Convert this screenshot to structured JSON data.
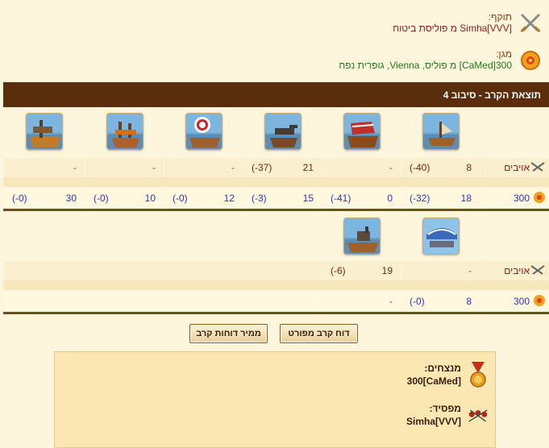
{
  "attacker": {
    "label": "תוקף:",
    "name": "Simha[VVV] מ פוליסת ביטוח"
  },
  "defender": {
    "label": "מגן:",
    "name": "300[CaMed] מ פוליס, Vienna, גופרית נפח"
  },
  "header": {
    "title": "תוצאת הקרב - סיבוב 4"
  },
  "round1": {
    "enemy_label": "אויבים",
    "own_count": "300",
    "enemy": [
      [
        "8",
        "(-40)"
      ],
      [
        "-",
        ""
      ],
      [
        "21",
        "(-37)"
      ],
      [
        "-",
        ""
      ],
      [
        "-",
        ""
      ],
      [
        "-",
        ""
      ]
    ],
    "own": [
      [
        "18",
        "(-32)"
      ],
      [
        "0",
        "(-41)"
      ],
      [
        "15",
        "(-3)"
      ],
      [
        "12",
        "(-0)"
      ],
      [
        "10",
        "(-0)"
      ],
      [
        "30",
        "(-0)"
      ]
    ]
  },
  "round2": {
    "enemy_label": "אויבים",
    "own_count": "300",
    "enemy": [
      [
        "-",
        ""
      ],
      [
        "19",
        "(-6)"
      ]
    ],
    "own": [
      [
        "8",
        "(-0)"
      ],
      [
        "-",
        ""
      ]
    ]
  },
  "buttons": {
    "detailed": "דוח קרב מפורט",
    "converter": "ממיר דוחות קרב"
  },
  "result": {
    "winners_label": "מנצחים:",
    "winners_name": "300[CaMed]",
    "loser_label": "מפסיד:",
    "loser_name": "Simha[VVV]"
  },
  "colors": {
    "header_bg": "#5a2e0c",
    "own_text": "#2a36b8",
    "enemy_text": "#6b2a0f"
  }
}
